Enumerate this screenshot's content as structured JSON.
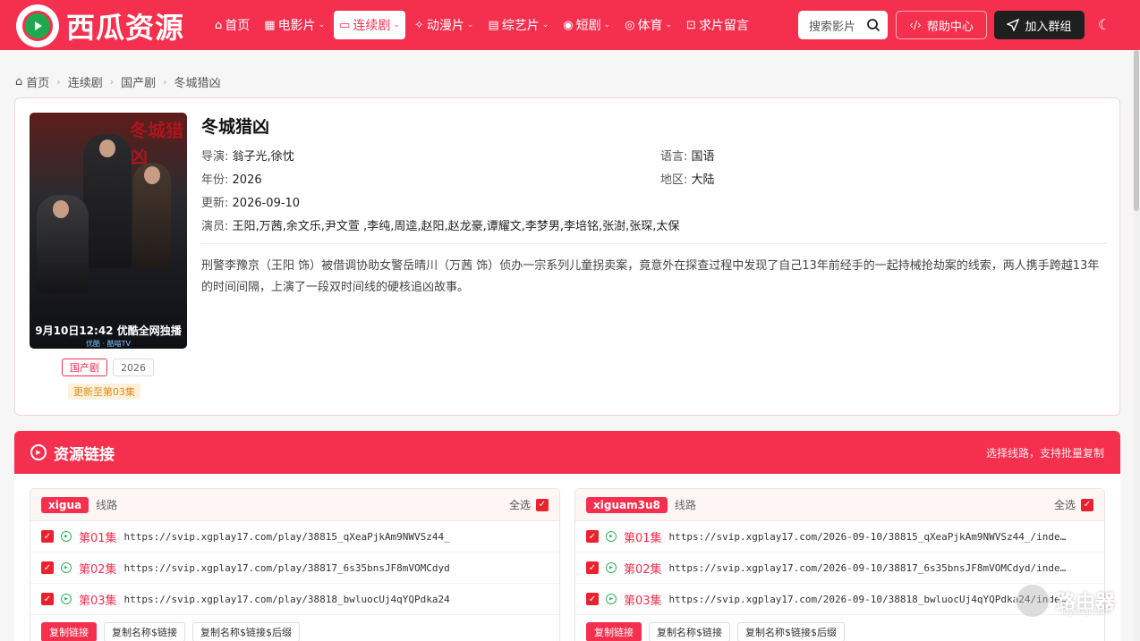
{
  "site": {
    "name": "西瓜资源"
  },
  "nav": {
    "items": [
      {
        "icon": "home-icon",
        "glyph": "⌂",
        "label": "首页",
        "dropdown": false,
        "active": false
      },
      {
        "icon": "film-icon",
        "glyph": "▦",
        "label": "电影片",
        "dropdown": true,
        "active": false
      },
      {
        "icon": "tv-icon",
        "glyph": "▭",
        "label": "连续剧",
        "dropdown": true,
        "active": true
      },
      {
        "icon": "wand-icon",
        "glyph": "✧",
        "label": "动漫片",
        "dropdown": true,
        "active": false
      },
      {
        "icon": "variety-icon",
        "glyph": "▤",
        "label": "综艺片",
        "dropdown": true,
        "active": false
      },
      {
        "icon": "play-circle-icon",
        "glyph": "◉",
        "label": "短剧",
        "dropdown": true,
        "active": false
      },
      {
        "icon": "sports-icon",
        "glyph": "◎",
        "label": "体育",
        "dropdown": true,
        "active": false
      },
      {
        "icon": "message-icon",
        "glyph": "⊡",
        "label": "求片留言",
        "dropdown": false,
        "active": false
      }
    ],
    "search_placeholder": "搜索影片",
    "help_label": "帮助中心",
    "join_label": "加入群组"
  },
  "breadcrumb": [
    "首页",
    "连续剧",
    "国产剧",
    "冬城猎凶"
  ],
  "detail": {
    "title": "冬城猎凶",
    "director_key": "导演:",
    "director": "翁子光,徐忱",
    "language_key": "语言:",
    "language": "国语",
    "year_key": "年份:",
    "year": "2026",
    "region_key": "地区:",
    "region": "大陆",
    "updated_key": "更新:",
    "updated": "2026-09-10",
    "cast_key": "演员:",
    "cast": "王阳,万茜,余文乐,尹文萱 ,李纯,周逵,赵阳,赵龙豪,谭耀文,李梦男,李培铭,张澍,张琛,太保",
    "description": "刑警李豫京（王阳 饰）被借调协助女警岳晴川（万茜 饰）侦办一宗系列儿童拐卖案，竟意外在探查过程中发现了自己13年前经手的一起持械抢劫案的线索，两人携手跨越13年的时间间隔，上演了一段双时间线的硬核追凶故事。",
    "tag_genre": "国产剧",
    "tag_year": "2026",
    "update_status": "更新至第03集",
    "poster": {
      "title": "冬城猎凶",
      "date_line": "9月10日12:42 优酷全网独播",
      "brand_line": "优酷 · 酷喵TV"
    }
  },
  "resources": {
    "title": "资源链接",
    "hint": "选择线路，支持批量复制",
    "lines": [
      {
        "source": "xigua",
        "line_label": "线路",
        "select_all": "全选",
        "episodes": [
          {
            "name": "第01集",
            "url": "https://svip.xgplay17.com/play/38815_qXeaPjkAm9NWVSz44_"
          },
          {
            "name": "第02集",
            "url": "https://svip.xgplay17.com/play/38817_6s35bnsJF8mVOMCdyd"
          },
          {
            "name": "第03集",
            "url": "https://svip.xgplay17.com/play/38818_bwluocUj4qYQPdka24"
          }
        ],
        "actions": [
          "复制链接",
          "复制名称$链接",
          "复制名称$链接$后缀"
        ]
      },
      {
        "source": "xiguam3u8",
        "line_label": "线路",
        "select_all": "全选",
        "episodes": [
          {
            "name": "第01集",
            "url": "https://svip.xgplay17.com/2026-09-10/38815_qXeaPjkAm9NWVSz44_/inde…"
          },
          {
            "name": "第02集",
            "url": "https://svip.xgplay17.com/2026-09-10/38817_6s35bnsJF8mVOMCdyd/inde…"
          },
          {
            "name": "第03集",
            "url": "https://svip.xgplay17.com/2026-09-10/38818_bwluocUj4qYQPdka24/inde…"
          }
        ],
        "actions": [
          "复制链接",
          "复制名称$链接",
          "复制名称$链接$后缀"
        ]
      }
    ]
  },
  "watermark": {
    "text": "路由器",
    "sub": "luyouqi.com"
  },
  "colors": {
    "brand": "#f5304e",
    "dark_button": "#1f1f1f",
    "play_green": "#2fb35f",
    "update_orange": "#e08c16"
  }
}
